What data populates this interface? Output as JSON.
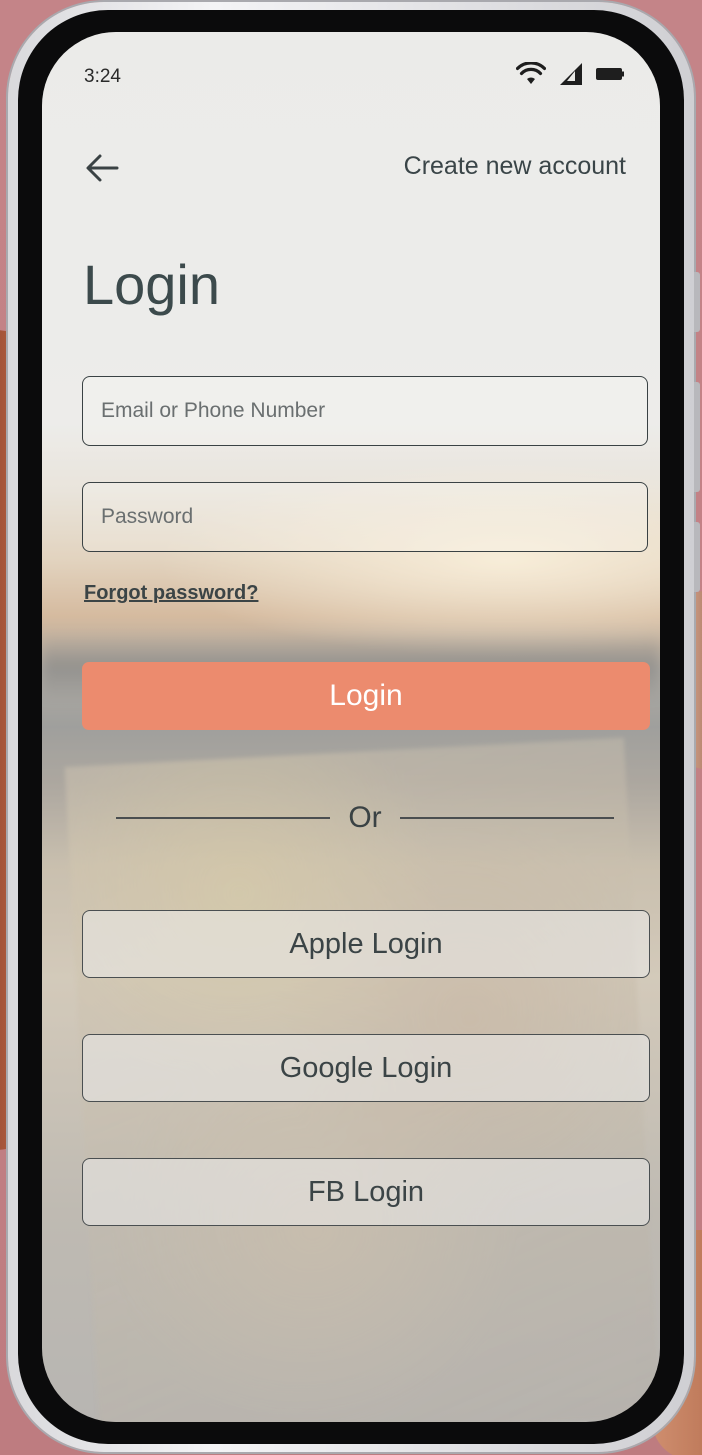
{
  "status_bar": {
    "time": "3:24",
    "icons": [
      "wifi-icon",
      "signal-icon",
      "battery-icon"
    ]
  },
  "nav": {
    "back_icon": "arrow-left-icon",
    "create_account_label": "Create new account"
  },
  "page": {
    "title": "Login"
  },
  "form": {
    "email_placeholder": "Email or Phone Number",
    "email_value": "",
    "password_placeholder": "Password",
    "password_value": "",
    "forgot_label": "Forgot password?",
    "login_label": "Login"
  },
  "divider": {
    "label": "Or"
  },
  "social": {
    "apple_label": "Apple Login",
    "google_label": "Google Login",
    "fb_label": "FB Login"
  },
  "colors": {
    "accent": "#ec8b6e",
    "background": "#c98184",
    "text_dark": "#3c4a4c"
  }
}
